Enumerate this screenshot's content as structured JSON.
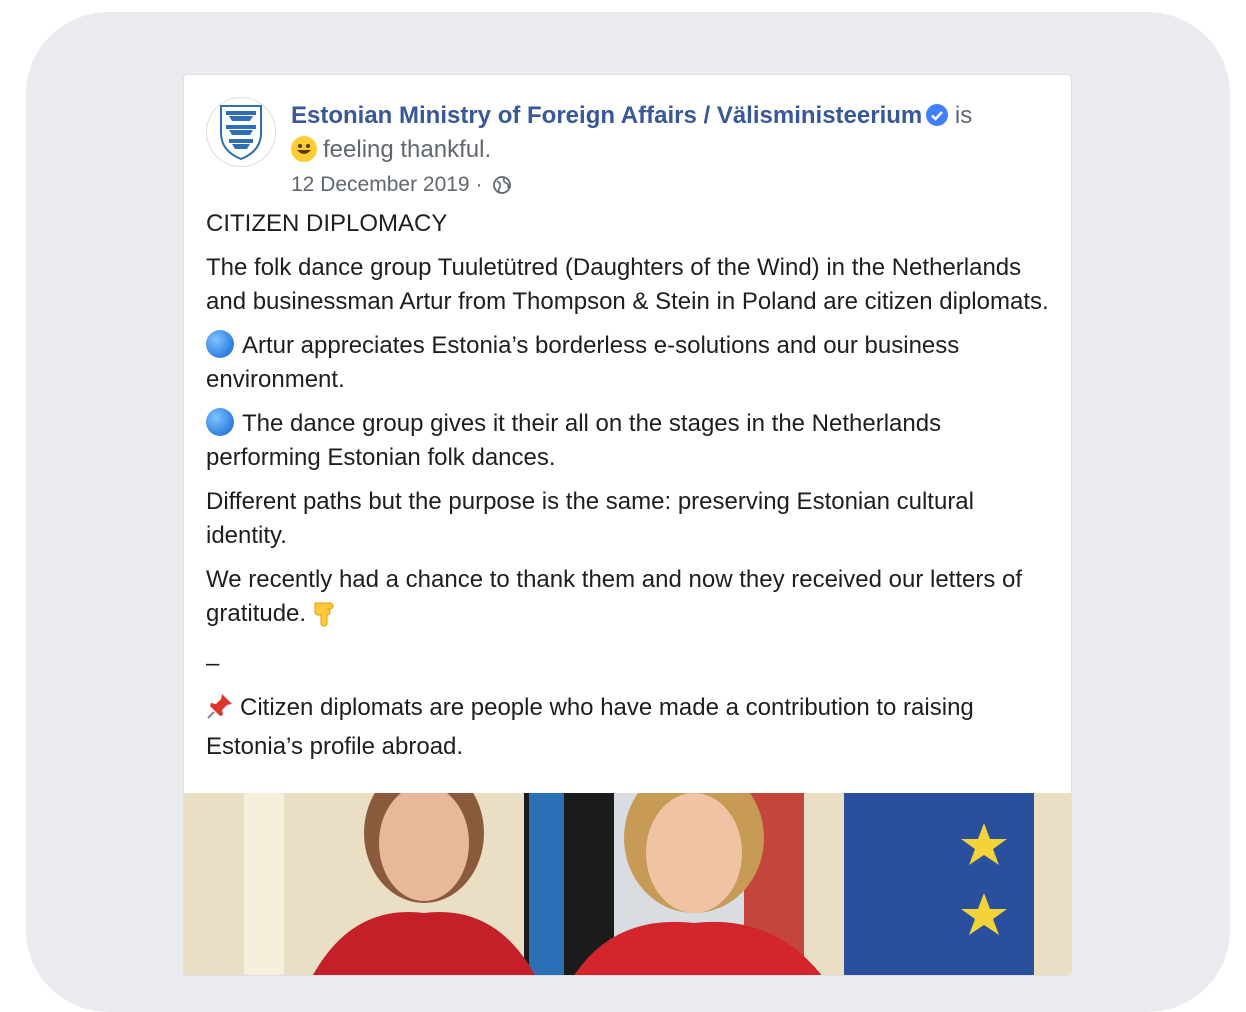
{
  "post": {
    "page_name": "Estonian Ministry of Foreign Affairs / Välisministeerium",
    "is_text": "is",
    "feeling": "feeling thankful.",
    "date": "12 December 2019",
    "date_sep": "·",
    "heading": "CITIZEN DIPLOMACY",
    "paragraphs": {
      "intro": "The folk dance group Tuuletütred (Daughters of the Wind) in the Netherlands and businessman Artur from Thompson & Stein in Poland are citizen diplomats.",
      "bullet1": "Artur appreciates Estonia’s borderless e-solutions and our business environment.",
      "bullet2": "The dance group gives it their all on the stages in the Netherlands performing Estonian folk dances.",
      "purpose": "Different paths but the purpose is the same: preserving Estonian cultural identity.",
      "thanks": "We recently had a chance to thank them and now they received our letters of gratitude.",
      "dash": "–",
      "pin_note": "Citizen diplomats are people who have made a contribution to raising Estonia’s profile abroad."
    }
  },
  "icons": {
    "avatar": "estonian-lions-coat-of-arms",
    "verified": "verified-badge-icon",
    "feeling": "grinning-face-emoji",
    "audience": "globe-icon",
    "bullet": "blue-circle-emoji",
    "hand": "pointing-down-hand-emoji",
    "pin": "pushpin-emoji"
  },
  "colors": {
    "page_name": "#385898",
    "meta_text": "#606770",
    "body_text": "#1c1e21",
    "verified": "#4080ff",
    "background_panel": "#e9ebee"
  }
}
